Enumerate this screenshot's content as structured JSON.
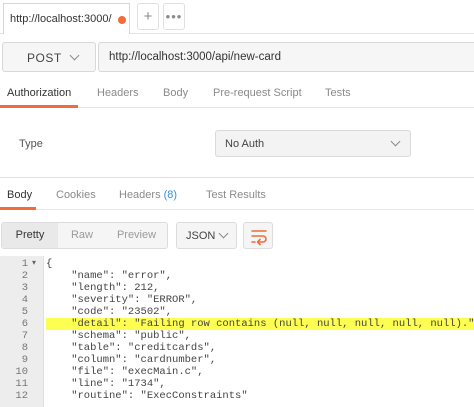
{
  "tabs": {
    "request_tab_url": "http://localhost:3000/",
    "add_label": "+",
    "more_label": "•••"
  },
  "request": {
    "method": "POST",
    "url": "http://localhost:3000/api/new-card"
  },
  "request_tabs": [
    "Authorization",
    "Headers",
    "Body",
    "Pre-request Script",
    "Tests"
  ],
  "auth": {
    "type_label": "Type",
    "type_value": "No Auth"
  },
  "response_tabs": {
    "body": "Body",
    "cookies": "Cookies",
    "headers": "Headers",
    "headers_count": "(8)",
    "test_results": "Test Results"
  },
  "response_toolbar": {
    "pretty": "Pretty",
    "raw": "Raw",
    "preview": "Preview",
    "format": "JSON"
  },
  "code": {
    "lines": [
      {
        "n": "1",
        "text": "{"
      },
      {
        "n": "2",
        "text": "    \"name\": \"error\","
      },
      {
        "n": "3",
        "text": "    \"length\": 212,"
      },
      {
        "n": "4",
        "text": "    \"severity\": \"ERROR\","
      },
      {
        "n": "5",
        "text": "    \"code\": \"23502\","
      },
      {
        "n": "6",
        "text": "    \"detail\": \"Failing row contains (null, null, null, null, null).\","
      },
      {
        "n": "7",
        "text": "    \"schema\": \"public\","
      },
      {
        "n": "8",
        "text": "    \"table\": \"creditcards\","
      },
      {
        "n": "9",
        "text": "    \"column\": \"cardnumber\","
      },
      {
        "n": "10",
        "text": "    \"file\": \"execMain.c\","
      },
      {
        "n": "11",
        "text": "    \"line\": \"1734\","
      },
      {
        "n": "12",
        "text": "    \"routine\": \"ExecConstraints\""
      }
    ],
    "fold_marker": "▾"
  },
  "colors": {
    "accent": "#f26b3a",
    "highlight": "#fdfd52",
    "count": "#3a8fd6"
  }
}
